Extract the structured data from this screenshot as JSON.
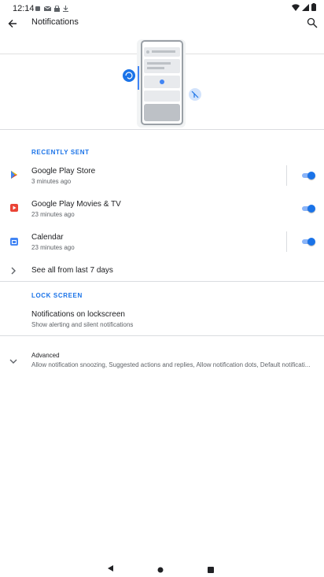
{
  "status_bar": {
    "time": "12:14"
  },
  "app_bar": {
    "title": "Notifications"
  },
  "sections": {
    "recently_sent_header": "RECENTLY SENT",
    "lock_screen_header": "LOCK SCREEN"
  },
  "recent_apps": [
    {
      "name": "Google Play Store",
      "time": "3 minutes ago",
      "enabled": true,
      "icon": "play-store-icon"
    },
    {
      "name": "Google Play Movies & TV",
      "time": "23 minutes ago",
      "enabled": true,
      "icon": "play-movies-icon"
    },
    {
      "name": "Calendar",
      "time": "23 minutes ago",
      "enabled": true,
      "icon": "calendar-icon"
    }
  ],
  "see_all_label": "See all from last 7 days",
  "lockscreen": {
    "title": "Notifications on lockscreen",
    "subtitle": "Show alerting and silent notifications"
  },
  "advanced": {
    "title": "Advanced",
    "subtitle": "Allow notification snoozing, Suggested actions and replies, Allow notification dots, Default notificati..."
  },
  "colors": {
    "accent": "#1a73e8",
    "accent_track": "#8ab4f8",
    "divider": "#dadce0"
  }
}
